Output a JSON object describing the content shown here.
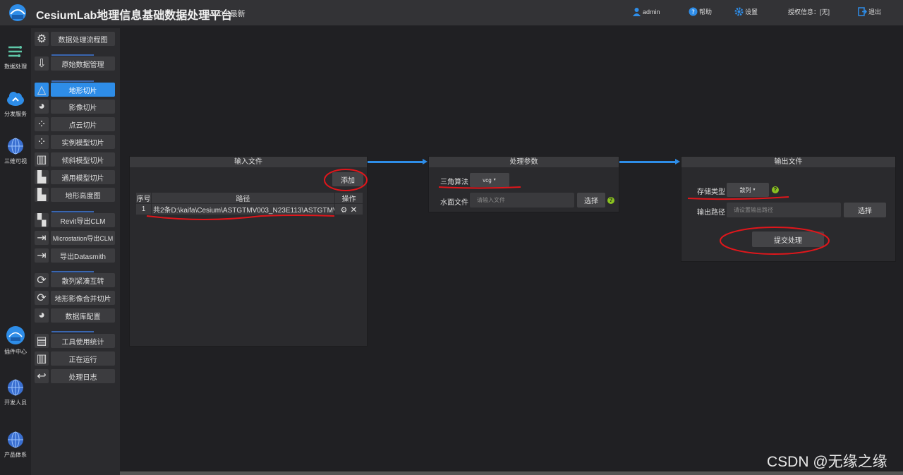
{
  "header": {
    "title": "CesiumLab地理信息基础数据处理平台",
    "version": "V4.0.6最新",
    "user": "admin",
    "help": "帮助",
    "settings": "设置",
    "license": "授权信息：[无]",
    "logout": "退出"
  },
  "leftnav": [
    {
      "label": "数据处理",
      "icon": "data-process-icon"
    },
    {
      "label": "分发服务",
      "icon": "cloud-icon"
    },
    {
      "label": "三维可视",
      "icon": "globe-icon"
    },
    {
      "label": "插件中心",
      "icon": "lab-icon"
    },
    {
      "label": "开发人员",
      "icon": "globe-icon"
    },
    {
      "label": "产品体系",
      "icon": "globe-icon"
    }
  ],
  "submenu": [
    {
      "label": "数据处理流程图",
      "icon": "gear-icon"
    },
    {
      "label": "原始数据管理",
      "icon": "download-icon"
    },
    {
      "label": "地形切片",
      "icon": "terrain-icon",
      "active": true
    },
    {
      "label": "影像切片",
      "icon": "image-icon"
    },
    {
      "label": "点云切片",
      "icon": "pointcloud-icon"
    },
    {
      "label": "实例模型切片",
      "icon": "instance-icon"
    },
    {
      "label": "倾斜模型切片",
      "icon": "oblique-icon"
    },
    {
      "label": "通用模型切片",
      "icon": "model-icon"
    },
    {
      "label": "地形高度图",
      "icon": "heightmap-icon"
    },
    {
      "label": "Revit导出CLM",
      "icon": "revit-icon"
    },
    {
      "label": "Microstation导出CLM",
      "icon": "export-icon"
    },
    {
      "label": "导出Datasmith",
      "icon": "export-icon"
    },
    {
      "label": "散列紧凑互转",
      "icon": "convert-icon"
    },
    {
      "label": "地形影像合并切片",
      "icon": "merge-icon"
    },
    {
      "label": "数据库配置",
      "icon": "database-icon"
    },
    {
      "label": "工具使用统计",
      "icon": "doc-icon"
    },
    {
      "label": "正在运行",
      "icon": "chart-icon"
    },
    {
      "label": "处理日志",
      "icon": "back-icon"
    }
  ],
  "input_panel": {
    "title": "输入文件",
    "add_button": "添加",
    "columns": [
      "序号",
      "路径",
      "操作"
    ],
    "rows": [
      {
        "index": "1",
        "path": "共2条D:\\kaifa\\Cesium\\ASTGTMV003_N23E113\\ASTGTMV…"
      }
    ]
  },
  "params_panel": {
    "title": "处理参数",
    "algo_label": "三角算法",
    "algo_value": "vcg",
    "water_label": "水面文件",
    "water_placeholder": "请输入文件",
    "select_button": "选择"
  },
  "output_panel": {
    "title": "输出文件",
    "storage_label": "存储类型",
    "storage_value": "散列",
    "path_label": "输出路径",
    "path_placeholder": "请设置输出路径",
    "select_button": "选择",
    "submit_button": "提交处理"
  },
  "watermark": "CSDN @无缘之缘",
  "colors": {
    "accent": "#2e8de8",
    "help": "#8ac220",
    "annotation": "#e0161b"
  }
}
